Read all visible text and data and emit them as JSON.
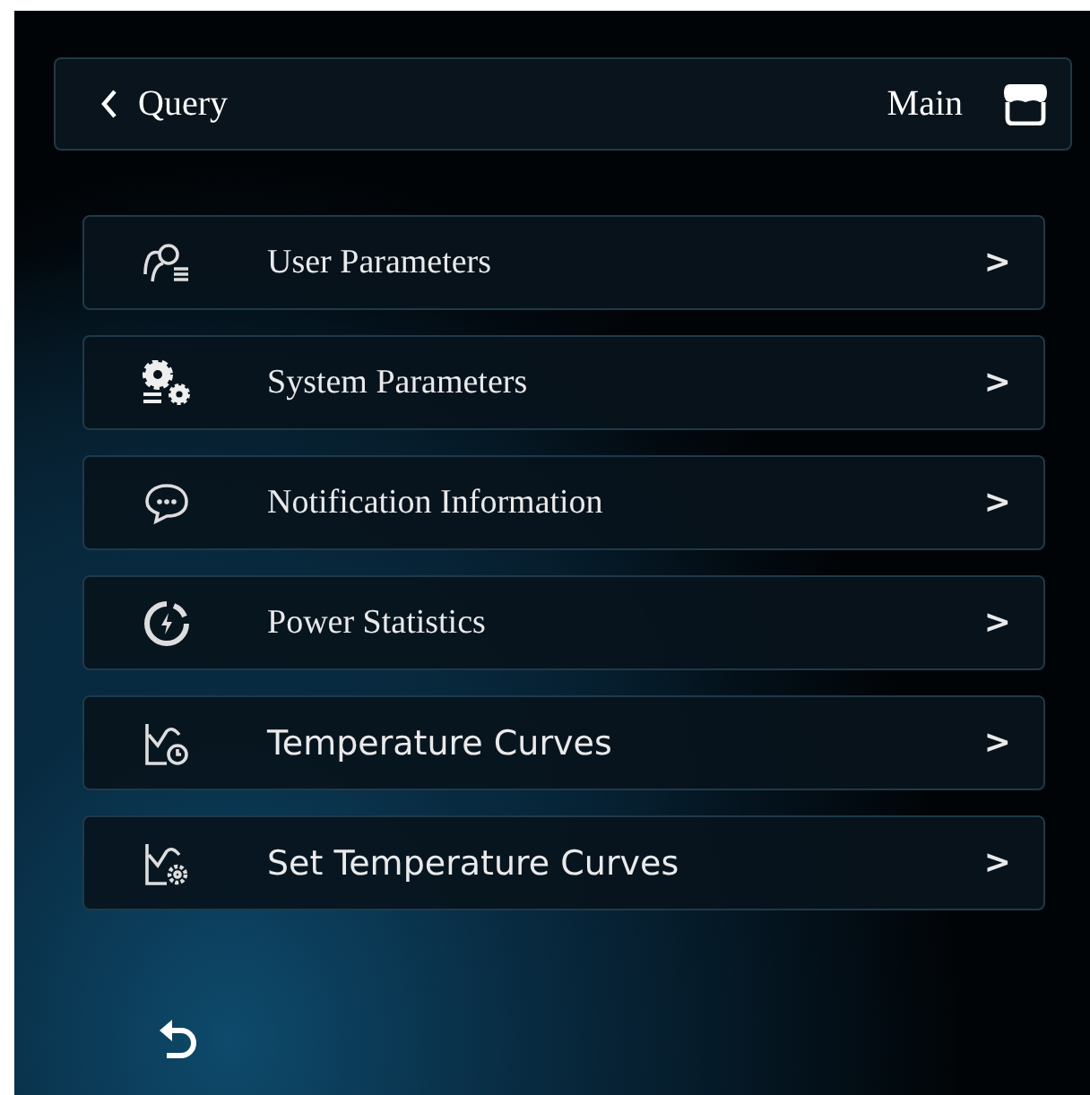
{
  "header": {
    "back_label": "Query",
    "main_label": "Main"
  },
  "menu_items": [
    {
      "kind": "users",
      "label": "User Parameters",
      "chevron": ">"
    },
    {
      "kind": "gears",
      "label": "System Parameters",
      "chevron": ">"
    },
    {
      "kind": "chat",
      "label": "Notification Information",
      "chevron": ">"
    },
    {
      "kind": "power",
      "label": "Power Statistics",
      "chevron": ">"
    },
    {
      "kind": "curve-clock",
      "label": "Temperature Curves",
      "chevron": ">"
    },
    {
      "kind": "curve-gear",
      "label": "Set Temperature Curves",
      "chevron": ">"
    }
  ]
}
